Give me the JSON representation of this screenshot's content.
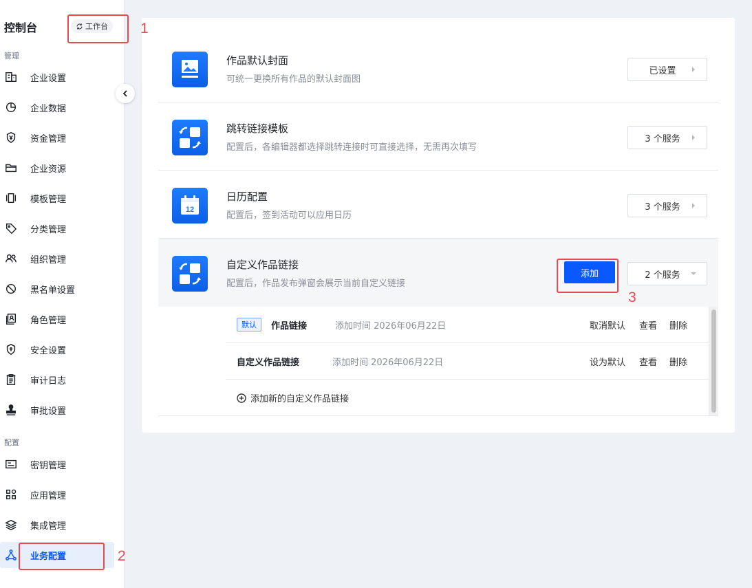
{
  "sidebar": {
    "title": "控制台",
    "switch_label": "工作台",
    "groups": {
      "manage": "管理",
      "config": "配置"
    },
    "items": [
      {
        "label": "企业设置",
        "icon": "building-icon"
      },
      {
        "label": "企业数据",
        "icon": "pie-chart-icon"
      },
      {
        "label": "资金管理",
        "icon": "shield-yen-icon"
      },
      {
        "label": "企业资源",
        "icon": "folder-icon"
      },
      {
        "label": "模板管理",
        "icon": "template-icon"
      },
      {
        "label": "分类管理",
        "icon": "tag-icon"
      },
      {
        "label": "组织管理",
        "icon": "users-icon"
      },
      {
        "label": "黑名单设置",
        "icon": "block-icon"
      },
      {
        "label": "角色管理",
        "icon": "role-icon"
      },
      {
        "label": "安全设置",
        "icon": "shield-icon"
      },
      {
        "label": "审计日志",
        "icon": "log-icon"
      },
      {
        "label": "审批设置",
        "icon": "stamp-icon"
      },
      {
        "label": "密钥管理",
        "icon": "key-card-icon"
      },
      {
        "label": "应用管理",
        "icon": "apps-icon"
      },
      {
        "label": "集成管理",
        "icon": "layers-icon"
      },
      {
        "label": "业务配置",
        "icon": "flow-icon"
      }
    ]
  },
  "annotations": {
    "n1": "1",
    "n2": "2",
    "n3": "3"
  },
  "settings": [
    {
      "title": "作品默认封面",
      "desc": "可统一更换所有作品的默认封面图",
      "value": "已设置",
      "icon": "image-icon"
    },
    {
      "title": "跳转链接模板",
      "desc": "配置后，各编辑器都选择跳转连接时可直接选择，无需再次填写",
      "value": "3 个服务",
      "icon": "link-switch-icon"
    },
    {
      "title": "日历配置",
      "desc": "配置后，签到活动可以应用日历",
      "value": "3 个服务",
      "icon": "calendar-icon",
      "calendar_day": "12"
    },
    {
      "title": "自定义作品链接",
      "desc": "配置后，作品发布弹窗会展示当前自定义链接",
      "value": "2 个服务",
      "icon": "link-switch-icon",
      "add_label": "添加"
    }
  ],
  "custom_links": [
    {
      "tag": "默认",
      "name": "作品链接",
      "time": "添加时间  2026年06月22日",
      "action1": "取消默认",
      "action2": "查看",
      "action3": "删除"
    },
    {
      "name": "自定义作品链接",
      "time": "添加时间  2026年06月22日",
      "action1": "设为默认",
      "action2": "查看",
      "action3": "删除"
    }
  ],
  "add_new_label": "添加新的自定义作品链接",
  "colors": {
    "accent": "#0a58ff",
    "annotation": "#e8484e"
  }
}
